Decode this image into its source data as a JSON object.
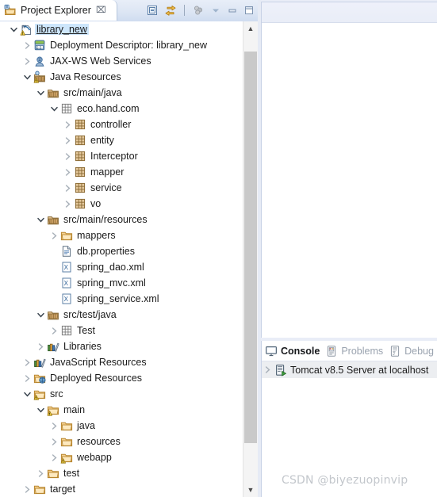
{
  "explorer": {
    "tab": {
      "label": "Project Explorer",
      "close_glyph": "⌧",
      "icon": "project-explorer-icon"
    },
    "toolbar": [
      {
        "name": "collapse-all-button",
        "title": "Collapse All"
      },
      {
        "name": "link-with-editor-button",
        "title": "Link with Editor"
      },
      {
        "name": "view-menu-button",
        "title": "View Menu"
      },
      {
        "name": "chevron-down-button",
        "title": "Show Chevron"
      },
      {
        "name": "minimize-button",
        "title": "Minimize"
      },
      {
        "name": "maximize-button",
        "title": "Maximize"
      }
    ],
    "scrollbar": {
      "up_glyph": "▲",
      "down_glyph": "▼"
    },
    "tree": [
      {
        "label": "library_new",
        "depth": 0,
        "twisty": "expanded",
        "icon": "maven-project-icon",
        "selected": true
      },
      {
        "label": "Deployment Descriptor: library_new",
        "depth": 1,
        "twisty": "collapsed",
        "icon": "deployment-descriptor-icon",
        "selected": false
      },
      {
        "label": "JAX-WS Web Services",
        "depth": 1,
        "twisty": "collapsed",
        "icon": "jaxws-icon",
        "selected": false
      },
      {
        "label": "Java Resources",
        "depth": 1,
        "twisty": "expanded",
        "icon": "java-resources-icon",
        "selected": false
      },
      {
        "label": "src/main/java",
        "depth": 2,
        "twisty": "expanded",
        "icon": "source-folder-icon",
        "selected": false
      },
      {
        "label": "eco.hand.com",
        "depth": 3,
        "twisty": "expanded",
        "icon": "package-empty-icon",
        "selected": false
      },
      {
        "label": "controller",
        "depth": 4,
        "twisty": "collapsed",
        "icon": "package-icon",
        "selected": false
      },
      {
        "label": "entity",
        "depth": 4,
        "twisty": "collapsed",
        "icon": "package-icon",
        "selected": false
      },
      {
        "label": "Interceptor",
        "depth": 4,
        "twisty": "collapsed",
        "icon": "package-icon",
        "selected": false
      },
      {
        "label": "mapper",
        "depth": 4,
        "twisty": "collapsed",
        "icon": "package-icon",
        "selected": false
      },
      {
        "label": "service",
        "depth": 4,
        "twisty": "collapsed",
        "icon": "package-icon",
        "selected": false
      },
      {
        "label": "vo",
        "depth": 4,
        "twisty": "collapsed",
        "icon": "package-icon",
        "selected": false
      },
      {
        "label": "src/main/resources",
        "depth": 2,
        "twisty": "expanded",
        "icon": "source-folder-icon",
        "selected": false
      },
      {
        "label": "mappers",
        "depth": 3,
        "twisty": "collapsed",
        "icon": "folder-icon",
        "selected": false
      },
      {
        "label": "db.properties",
        "depth": 3,
        "twisty": "none",
        "icon": "properties-file-icon",
        "selected": false
      },
      {
        "label": "spring_dao.xml",
        "depth": 3,
        "twisty": "none",
        "icon": "xml-file-icon",
        "selected": false
      },
      {
        "label": "spring_mvc.xml",
        "depth": 3,
        "twisty": "none",
        "icon": "xml-file-icon",
        "selected": false
      },
      {
        "label": "spring_service.xml",
        "depth": 3,
        "twisty": "none",
        "icon": "xml-file-icon",
        "selected": false
      },
      {
        "label": "src/test/java",
        "depth": 2,
        "twisty": "expanded",
        "icon": "source-folder-icon",
        "selected": false
      },
      {
        "label": "Test",
        "depth": 3,
        "twisty": "collapsed",
        "icon": "package-empty-icon",
        "selected": false
      },
      {
        "label": "Libraries",
        "depth": 2,
        "twisty": "collapsed",
        "icon": "libraries-icon",
        "selected": false
      },
      {
        "label": "JavaScript Resources",
        "depth": 1,
        "twisty": "collapsed",
        "icon": "libraries-icon",
        "selected": false
      },
      {
        "label": "Deployed Resources",
        "depth": 1,
        "twisty": "collapsed",
        "icon": "deployed-resources-icon",
        "selected": false
      },
      {
        "label": "src",
        "depth": 1,
        "twisty": "expanded",
        "icon": "folder-warning-icon",
        "selected": false
      },
      {
        "label": "main",
        "depth": 2,
        "twisty": "expanded",
        "icon": "folder-warning-icon",
        "selected": false
      },
      {
        "label": "java",
        "depth": 3,
        "twisty": "collapsed",
        "icon": "folder-icon",
        "selected": false
      },
      {
        "label": "resources",
        "depth": 3,
        "twisty": "collapsed",
        "icon": "folder-icon",
        "selected": false
      },
      {
        "label": "webapp",
        "depth": 3,
        "twisty": "collapsed",
        "icon": "folder-warning-icon",
        "selected": false
      },
      {
        "label": "test",
        "depth": 2,
        "twisty": "collapsed",
        "icon": "folder-icon",
        "selected": false
      },
      {
        "label": "target",
        "depth": 1,
        "twisty": "collapsed",
        "icon": "folder-icon",
        "selected": false
      }
    ]
  },
  "console": {
    "tabs": [
      {
        "label": "Console",
        "icon": "console-icon",
        "active": true
      },
      {
        "label": "Problems",
        "icon": "problems-icon",
        "active": false
      },
      {
        "label": "Debug",
        "icon": "debug-icon",
        "active": false
      }
    ],
    "rows": [
      {
        "label": "Tomcat v8.5 Server at localhost",
        "icon": "server-icon",
        "twisty": "collapsed",
        "selected": true
      }
    ]
  },
  "watermark": {
    "text": "CSDN @biyezuopinvip"
  },
  "colors": {
    "selection": "#cde6fb",
    "tab_gradient_top": "#e8eef8",
    "tab_gradient_bottom": "#cfdcf0",
    "scrollbar_thumb": "#c9c9c9",
    "console_row_selection": "#eceef1",
    "watermark": "#c3c7cc"
  }
}
